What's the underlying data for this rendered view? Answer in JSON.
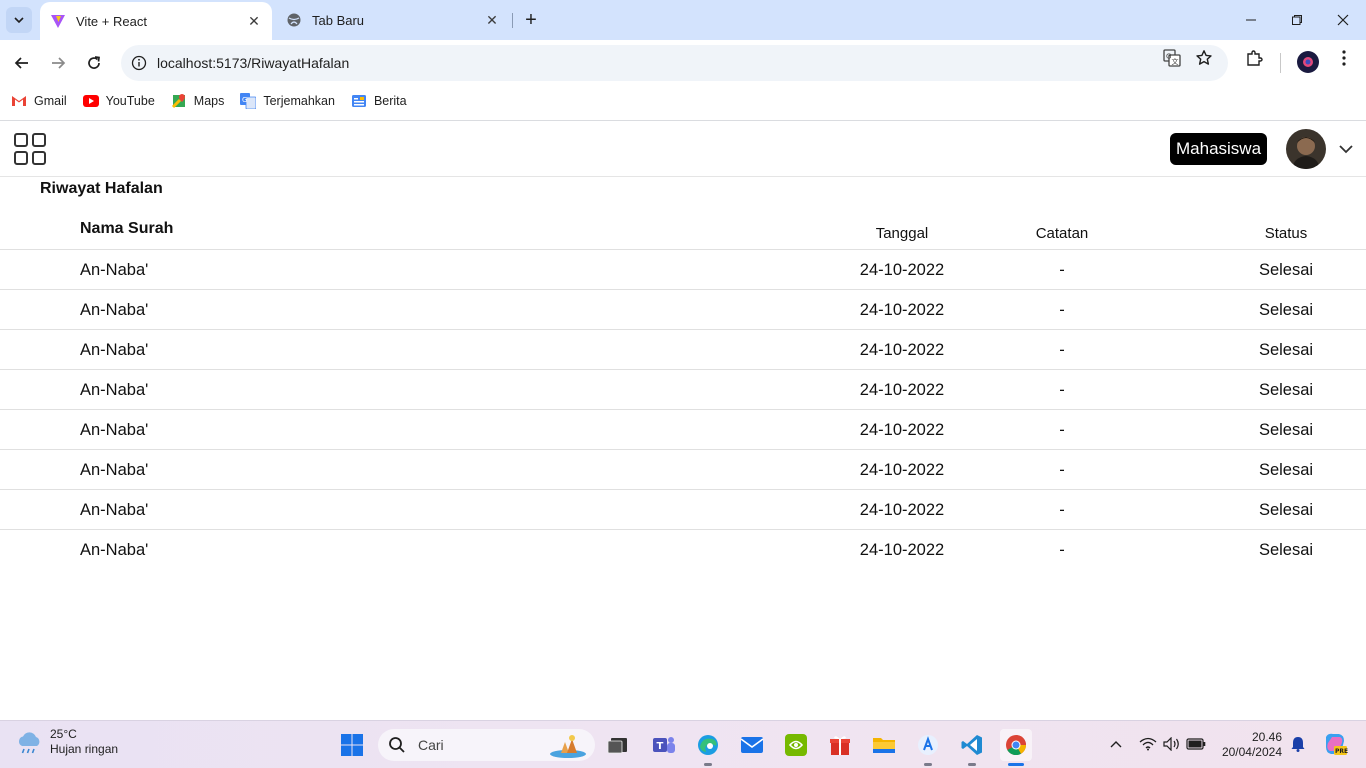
{
  "browser": {
    "tabs": [
      {
        "title": "Vite + React",
        "active": true
      },
      {
        "title": "Tab Baru",
        "active": false
      }
    ],
    "address": {
      "host": "localhost:5173",
      "path": "/RiwayatHafalan"
    },
    "bookmarks": [
      "Gmail",
      "YouTube",
      "Maps",
      "Terjemahkan",
      "Berita"
    ]
  },
  "app": {
    "role_badge": "Mahasiswa",
    "page_title": "Riwayat Hafalan",
    "table": {
      "headers": {
        "name": "Nama Surah",
        "date": "Tanggal",
        "note": "Catatan",
        "status": "Status"
      },
      "rows": [
        {
          "name": "An-Naba'",
          "date": "24-10-2022",
          "note": "-",
          "status": "Selesai"
        },
        {
          "name": "An-Naba'",
          "date": "24-10-2022",
          "note": "-",
          "status": "Selesai"
        },
        {
          "name": "An-Naba'",
          "date": "24-10-2022",
          "note": "-",
          "status": "Selesai"
        },
        {
          "name": "An-Naba'",
          "date": "24-10-2022",
          "note": "-",
          "status": "Selesai"
        },
        {
          "name": "An-Naba'",
          "date": "24-10-2022",
          "note": "-",
          "status": "Selesai"
        },
        {
          "name": "An-Naba'",
          "date": "24-10-2022",
          "note": "-",
          "status": "Selesai"
        },
        {
          "name": "An-Naba'",
          "date": "24-10-2022",
          "note": "-",
          "status": "Selesai"
        },
        {
          "name": "An-Naba'",
          "date": "24-10-2022",
          "note": "-",
          "status": "Selesai"
        }
      ]
    }
  },
  "taskbar": {
    "weather": {
      "temp": "25°C",
      "desc": "Hujan ringan"
    },
    "search_placeholder": "Cari",
    "clock": {
      "time": "20.46",
      "date": "20/04/2024"
    }
  },
  "colors": {
    "tabstrip": "#d3e3fd",
    "omnibox": "#f0f4f9",
    "badge_bg": "#000000"
  }
}
